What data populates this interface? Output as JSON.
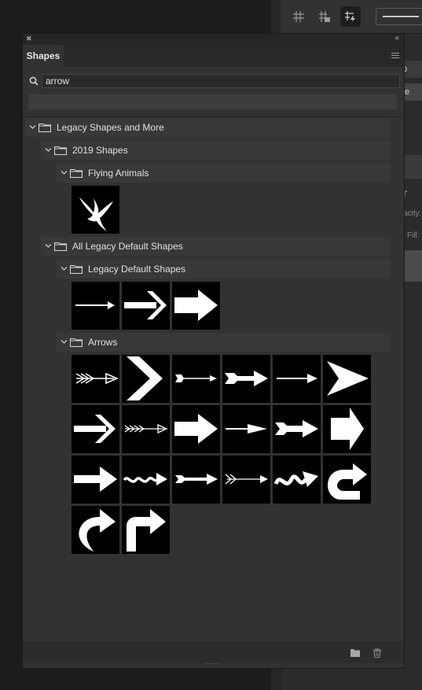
{
  "panel": {
    "tab_label": "Shapes",
    "search": {
      "value": "arrow",
      "placeholder": ""
    },
    "tree": {
      "root": "Legacy Shapes and More",
      "group_2019": "2019 Shapes",
      "flying_animals": "Flying Animals",
      "all_legacy": "All Legacy Default Shapes",
      "legacy_default": "Legacy Default Shapes",
      "arrows": "Arrows"
    }
  },
  "right_panel": {
    "peek_p": "p",
    "peek_te": "te",
    "opacity_label": "acity:",
    "fill_label": "Fill:"
  },
  "icons": [
    "collapse-icon",
    "close-icon",
    "panel-menu-icon",
    "search-icon",
    "chevron-down-icon",
    "folder-icon",
    "new-group-icon",
    "trash-icon"
  ],
  "colors": {
    "panel_bg": "#323232",
    "row_bg": "#383838",
    "tile_bg": "#000000",
    "shape_fill": "#ffffff",
    "text": "#e0e0e0"
  }
}
